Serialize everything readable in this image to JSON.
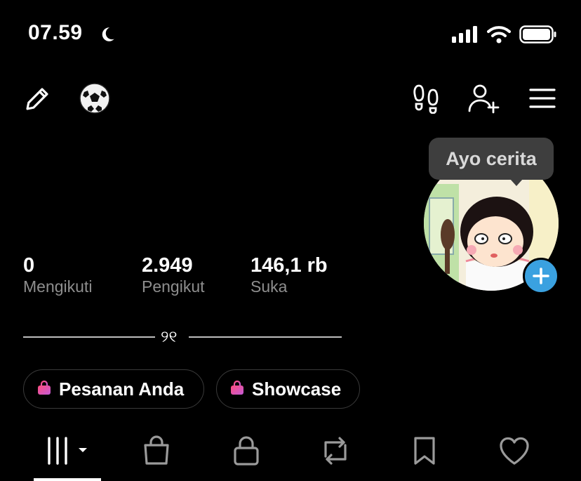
{
  "status_bar": {
    "time": "07.59"
  },
  "tooltip": {
    "text": "Ayo cerita"
  },
  "stats": [
    {
      "value": "0",
      "label": "Mengikuti"
    },
    {
      "value": "2.949",
      "label": "Pengikut"
    },
    {
      "value": "146,1 rb",
      "label": "Suka"
    }
  ],
  "bio": {
    "text": "୨୧"
  },
  "pills": [
    {
      "label": "Pesanan Anda",
      "icon": "shopping-bag-icon"
    },
    {
      "label": "Showcase",
      "icon": "shopping-bag-icon"
    }
  ],
  "tabs": [
    {
      "icon": "grid-icon",
      "active": true
    },
    {
      "icon": "shopping-bag-icon"
    },
    {
      "icon": "lock-icon"
    },
    {
      "icon": "repost-icon"
    },
    {
      "icon": "bookmark-icon"
    },
    {
      "icon": "heart-icon"
    }
  ],
  "colors": {
    "accent_blue": "#3aa1e0",
    "pill_bag_pink": "#ff4d7d",
    "muted": "#8e8e8e"
  }
}
